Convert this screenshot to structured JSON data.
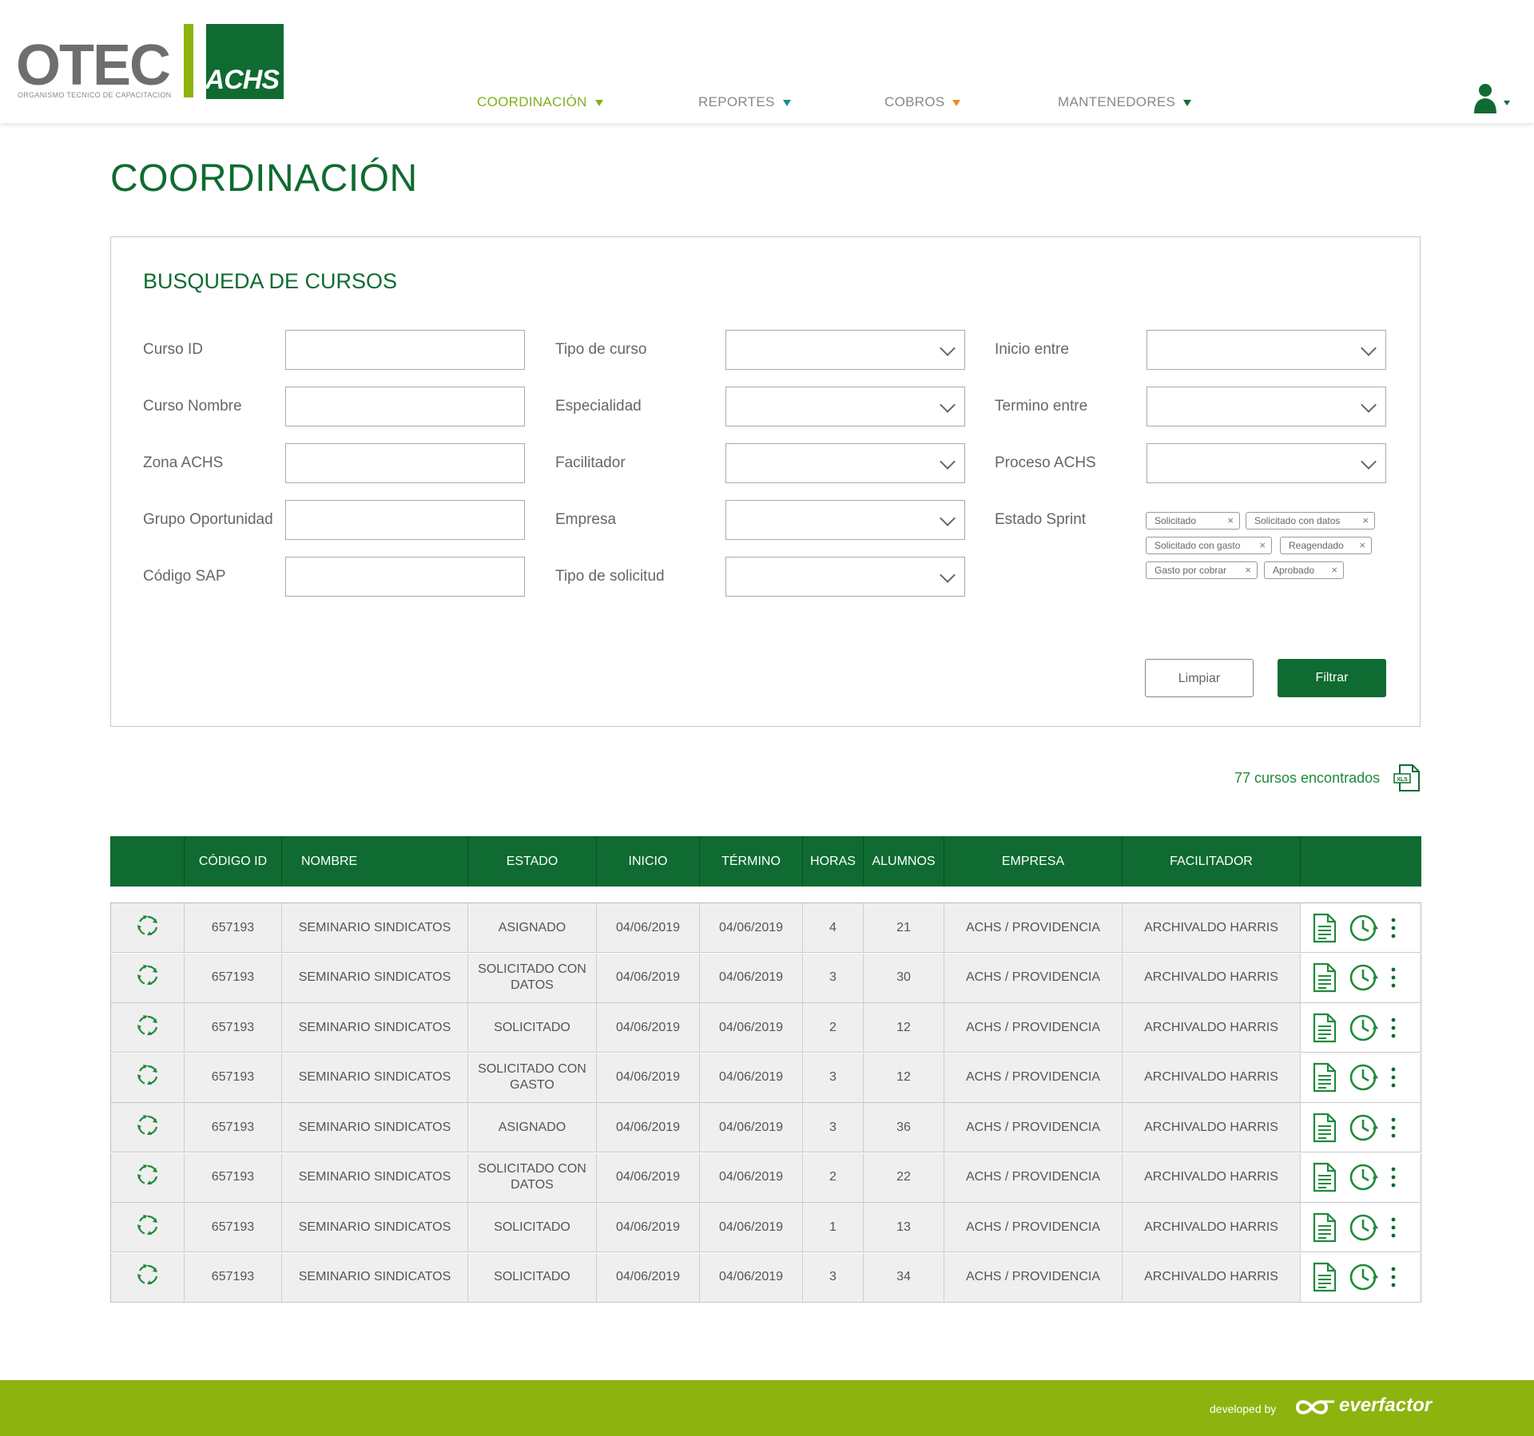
{
  "brand": {
    "otec": "OTEC",
    "otec_subtitle": "ORGANISMO TECNICO DE CAPACITACION",
    "achs": "ACHS",
    "green": "#0f6b31",
    "lime": "#8db30f"
  },
  "nav": {
    "items": [
      {
        "label": "COORDINACIÓN",
        "active": true
      },
      {
        "label": "REPORTES"
      },
      {
        "label": "COBROS"
      },
      {
        "label": "MANTENEDORES"
      }
    ],
    "user_icon": "user-icon"
  },
  "page": {
    "title": "COORDINACIÓN"
  },
  "search": {
    "title": "BUSQUEDA DE CURSOS",
    "fields": {
      "curso_id": "Curso ID",
      "curso_nombre": "Curso Nombre",
      "zona_achs": "Zona ACHS",
      "grupo_oportunidad": "Grupo Oportunidad",
      "codigo_sap": "Código SAP",
      "tipo_curso": "Tipo de curso",
      "especialidad": "Especialidad",
      "facilitador": "Facilitador",
      "empresa": "Empresa",
      "tipo_solicitud": "Tipo de solicitud",
      "inicio_entre": "Inicio entre",
      "termino_entre": "Termino entre",
      "proceso_achs": "Proceso ACHS",
      "estado_sprint": "Estado Sprint"
    },
    "estado_tags": [
      "Solicitado",
      "Solicitado con datos",
      "Solicitado con gasto",
      "Reagendado",
      "Gasto por cobrar",
      "Aprobado"
    ],
    "clear_label": "Limpiar",
    "filter_label": "Filtrar"
  },
  "results": {
    "count_text": "77 cursos encontrados",
    "export_icon": "xls-icon"
  },
  "table": {
    "headers": [
      "CÓDIGO ID",
      "NOMBRE",
      "ESTADO",
      "INICIO",
      "TÉRMINO",
      "HORAS",
      "ALUMNOS",
      "EMPRESA",
      "FACILITADOR"
    ],
    "rows": [
      {
        "codigo": "657193",
        "nombre": "SEMINARIO SINDICATOS",
        "estado": "ASIGNADO",
        "inicio": "04/06/2019",
        "termino": "04/06/2019",
        "horas": "4",
        "alumnos": "21",
        "empresa": "ACHS / PROVIDENCIA",
        "facilitador": "ARCHIVALDO HARRIS"
      },
      {
        "codigo": "657193",
        "nombre": "SEMINARIO SINDICATOS",
        "estado": "SOLICITADO CON DATOS",
        "inicio": "04/06/2019",
        "termino": "04/06/2019",
        "horas": "3",
        "alumnos": "30",
        "empresa": "ACHS / PROVIDENCIA",
        "facilitador": "ARCHIVALDO HARRIS"
      },
      {
        "codigo": "657193",
        "nombre": "SEMINARIO SINDICATOS",
        "estado": "SOLICITADO",
        "inicio": "04/06/2019",
        "termino": "04/06/2019",
        "horas": "2",
        "alumnos": "12",
        "empresa": "ACHS / PROVIDENCIA",
        "facilitador": "ARCHIVALDO HARRIS"
      },
      {
        "codigo": "657193",
        "nombre": "SEMINARIO SINDICATOS",
        "estado": "SOLICITADO CON GASTO",
        "inicio": "04/06/2019",
        "termino": "04/06/2019",
        "horas": "3",
        "alumnos": "12",
        "empresa": "ACHS / PROVIDENCIA",
        "facilitador": "ARCHIVALDO HARRIS"
      },
      {
        "codigo": "657193",
        "nombre": "SEMINARIO SINDICATOS",
        "estado": "ASIGNADO",
        "inicio": "04/06/2019",
        "termino": "04/06/2019",
        "horas": "3",
        "alumnos": "36",
        "empresa": "ACHS / PROVIDENCIA",
        "facilitador": "ARCHIVALDO HARRIS"
      },
      {
        "codigo": "657193",
        "nombre": "SEMINARIO SINDICATOS",
        "estado": "SOLICITADO CON DATOS",
        "inicio": "04/06/2019",
        "termino": "04/06/2019",
        "horas": "2",
        "alumnos": "22",
        "empresa": "ACHS / PROVIDENCIA",
        "facilitador": "ARCHIVALDO HARRIS"
      },
      {
        "codigo": "657193",
        "nombre": "SEMINARIO SINDICATOS",
        "estado": "SOLICITADO",
        "inicio": "04/06/2019",
        "termino": "04/06/2019",
        "horas": "1",
        "alumnos": "13",
        "empresa": "ACHS / PROVIDENCIA",
        "facilitador": "ARCHIVALDO HARRIS"
      },
      {
        "codigo": "657193",
        "nombre": "SEMINARIO SINDICATOS",
        "estado": "SOLICITADO",
        "inicio": "04/06/2019",
        "termino": "04/06/2019",
        "horas": "3",
        "alumnos": "34",
        "empresa": "ACHS / PROVIDENCIA",
        "facilitador": "ARCHIVALDO HARRIS"
      }
    ],
    "row_icons": [
      "refresh-icon",
      "document-icon",
      "schedule-icon",
      "more-vertical-icon"
    ]
  },
  "footer": {
    "developed_by": "developed by",
    "company": "everfactor"
  }
}
